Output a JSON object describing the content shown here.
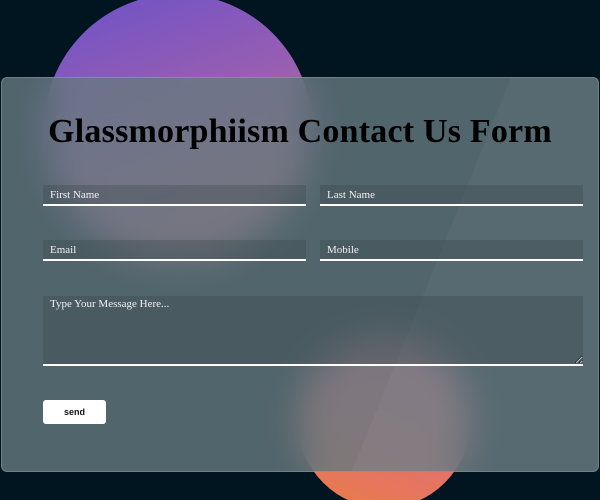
{
  "form": {
    "title": "Glassmorphiism Contact Us Form",
    "first_name_placeholder": "First Name",
    "last_name_placeholder": "Last Name",
    "email_placeholder": "Email",
    "mobile_placeholder": "Mobile",
    "message_placeholder": "Type Your Message Here...",
    "send_label": "send"
  },
  "colors": {
    "background": "#011521",
    "glass_panel": "#65797f",
    "blob_top": "#8a5bbf",
    "blob_bottom": "#e36d6a",
    "field_underline": "#ffffff",
    "button": "#ffffff"
  }
}
